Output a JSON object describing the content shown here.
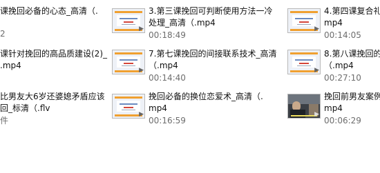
{
  "files": [
    {
      "thumb": "none",
      "name": [
        "课挽回必备的心态_高清（.",
        "2"
      ],
      "meta": ""
    },
    {
      "thumb": "slide",
      "name": [
        "3.第三课挽回可判断使用方法一冷",
        "处理_高清（.mp4"
      ],
      "meta": "00:18:49"
    },
    {
      "thumb": "slide",
      "name": [
        "4.第四课复合礼",
        "mp4"
      ],
      "meta": "00:14:05"
    },
    {
      "thumb": "none",
      "name": [
        "课针对挽回的高品质建设(2)_",
        ".mp4"
      ],
      "meta": ""
    },
    {
      "thumb": "slide",
      "name": [
        "7.第七课挽回的间接联系技术_高清",
        "（.mp4"
      ],
      "meta": "00:14:40"
    },
    {
      "thumb": "slide",
      "name": [
        "8.第八课挽回的",
        "（.mp4"
      ],
      "meta": "00:27:10"
    },
    {
      "thumb": "none",
      "name": [
        "比男友大6岁还婆媳矛盾应该",
        "回_标清（.flv"
      ],
      "meta": "件"
    },
    {
      "thumb": "slide",
      "name": [
        "挽回必备的换位恋爱术_高清（.",
        "mp4"
      ],
      "meta": "00:16:59"
    },
    {
      "thumb": "photo",
      "name": [
        "挽回前男友案例",
        "mp4"
      ],
      "meta": "00:06:29"
    }
  ]
}
